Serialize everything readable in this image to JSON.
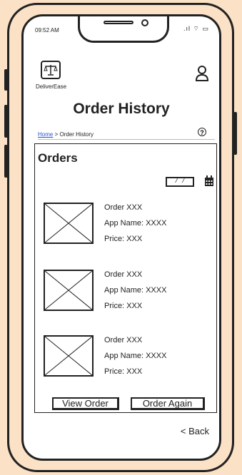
{
  "status_bar": {
    "time": "09:52 AM",
    "icons": ".ıl ⌔ ▭"
  },
  "header": {
    "logo_text": "DeliverEase",
    "title": "Order History"
  },
  "breadcrumb": {
    "home": "Home",
    "separator": ">",
    "current": "Order History"
  },
  "orders": {
    "title": "Orders",
    "date_placeholder": "/ /",
    "items": [
      {
        "order": "Order XXX",
        "app": "App Name: XXXX",
        "price": "Price: XXX"
      },
      {
        "order": "Order XXX",
        "app": "App Name: XXXX",
        "price": "Price: XXX"
      },
      {
        "order": "Order XXX",
        "app": "App Name: XXXX",
        "price": "Price: XXX"
      }
    ],
    "view_button": "View Order",
    "again_button": "Order Again"
  },
  "footer": {
    "back": "< Back"
  },
  "colors": {
    "background": "#fbe1c6",
    "link": "#2255cc",
    "ink": "#222222"
  }
}
